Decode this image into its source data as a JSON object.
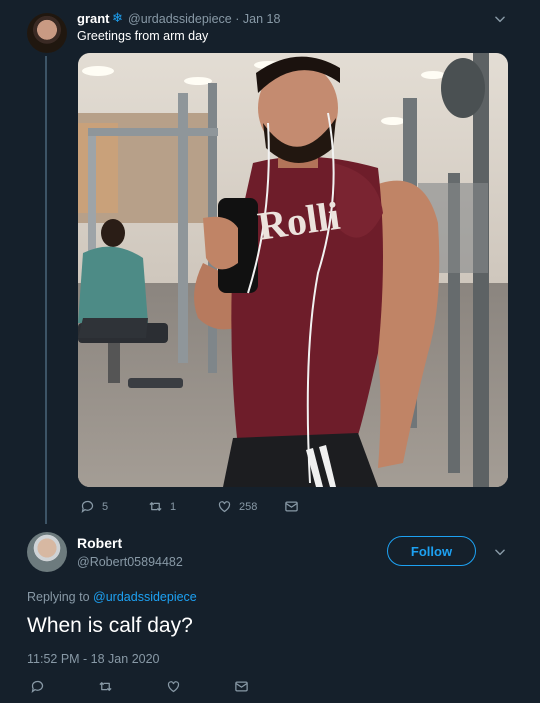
{
  "colors": {
    "background": "#15202b",
    "accent": "#1da1f2",
    "muted": "#8899a6"
  },
  "original_tweet": {
    "display_name": "grant",
    "badge_icon": "snowflake-icon",
    "handle": "@urdadssidepiece",
    "separator": "·",
    "date": "Jan 18",
    "text": "Greetings from arm day",
    "replies": "5",
    "retweets": "1",
    "likes": "258"
  },
  "reply": {
    "display_name": "Robert",
    "handle": "@Robert05894482",
    "follow_label": "Follow",
    "replying_to_prefix": "Replying to",
    "replying_to_handle": "@urdadssidepiece",
    "text": "When is calf day?",
    "timestamp": "11:52 PM - 18 Jan 2020"
  },
  "photo_text": {
    "shirt_print": "Rolli"
  }
}
